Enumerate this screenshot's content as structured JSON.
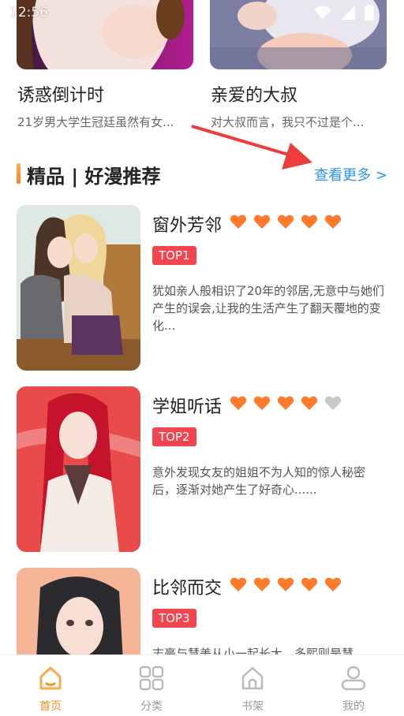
{
  "status_bar": {
    "time": "12:56"
  },
  "top_cards": [
    {
      "title": "诱惑倒计时",
      "desc": "21岁男大学生冠廷虽然有女..."
    },
    {
      "title": "亲爱的大叔",
      "desc": "对大叔而言，我只不过是个..."
    }
  ],
  "section": {
    "title": "精品 | 好漫推荐",
    "see_more": "查看更多 >"
  },
  "books": [
    {
      "title": "窗外芳邻",
      "rank": "TOP1",
      "rating": 5,
      "desc": "犹如亲人般相识了20年的邻居,无意中与她们产生的误会,让我的生活产生了翻天覆地的变化..."
    },
    {
      "title": "学姐听话",
      "rank": "TOP2",
      "rating": 4,
      "desc": "意外发现女友的姐姐不为人知的惊人秘密后，逐渐对她产生了好奇心......"
    },
    {
      "title": "比邻而交",
      "rank": "TOP3",
      "rating": 5,
      "desc": "志豪与慧美从小一起长大，多熙则是慧"
    }
  ],
  "colors": {
    "heart_on": "#ff7a2b",
    "heart_off": "#c8c8c8",
    "accent": "#ff8a24",
    "link": "#2e93e8",
    "badge": "#f2454f"
  },
  "nav": [
    {
      "label": "首页",
      "icon": "home-icon",
      "active": true
    },
    {
      "label": "分类",
      "icon": "category-grid-icon",
      "active": false
    },
    {
      "label": "书架",
      "icon": "bookshelf-icon",
      "active": false
    },
    {
      "label": "我的",
      "icon": "profile-icon",
      "active": false
    }
  ]
}
